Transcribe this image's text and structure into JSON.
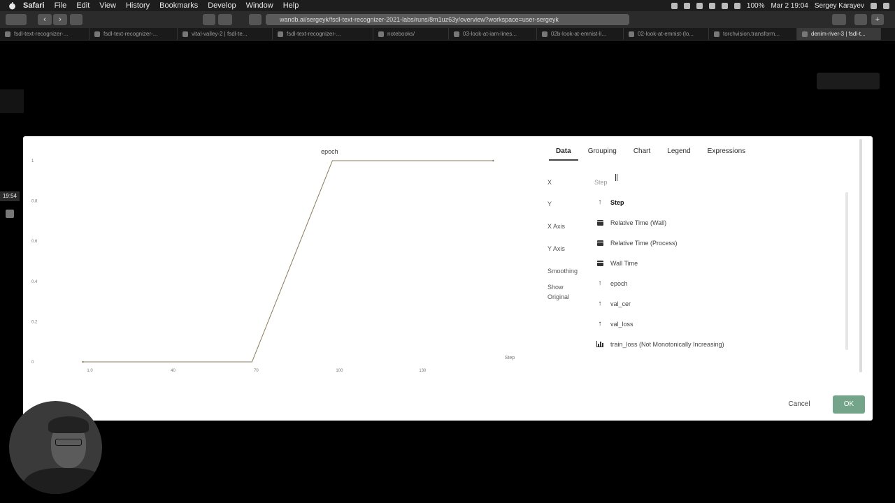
{
  "menubar": {
    "app_name": "Safari",
    "menus": [
      "File",
      "Edit",
      "View",
      "History",
      "Bookmarks",
      "Develop",
      "Window",
      "Help"
    ],
    "battery": "100%",
    "date_time": "Mar 2  19:04",
    "user": "Sergey Karayev"
  },
  "browser": {
    "url": "wandb.ai/sergeyk/fsdl-text-recognizer-2021-labs/runs/8m1uz63y/overview?workspace=user-sergeyk",
    "tabs": [
      {
        "label": "fsdl-text-recognizer-..."
      },
      {
        "label": "fsdl-text-recognizer-..."
      },
      {
        "label": "vital-valley-2 | fsdl-te..."
      },
      {
        "label": "fsdl-text-recognizer-..."
      },
      {
        "label": "notebooks/"
      },
      {
        "label": "03-look-at-iam-lines..."
      },
      {
        "label": "02b-look-at-emnist-li..."
      },
      {
        "label": "02-look-at-emnist-(lo..."
      },
      {
        "label": "torchvision.transform..."
      },
      {
        "label": "denim-river-3 | fsdl-t..."
      }
    ]
  },
  "background": {
    "time_label": "19:54"
  },
  "chart_data": {
    "type": "line",
    "title": "epoch",
    "xlabel": "Step",
    "ylabel": "",
    "x": [
      10,
      71,
      100,
      158
    ],
    "y": [
      0,
      0,
      1,
      1
    ],
    "xlim": [
      -4,
      170
    ],
    "ylim": [
      0,
      1
    ],
    "xticks": [
      10,
      40,
      70,
      100,
      130
    ],
    "xtick_labels": [
      "1.0",
      "40",
      "70",
      "100",
      "130"
    ],
    "yticks": [
      0,
      0.2,
      0.4,
      0.6,
      0.8,
      1
    ],
    "ytick_labels": [
      "0",
      "0.2",
      "0.4",
      "0.6",
      "0.8",
      "1"
    ],
    "line_color": "#8a7a5a",
    "grid": false,
    "legend": "none"
  },
  "config": {
    "tabs": [
      {
        "label": "Data",
        "active": true
      },
      {
        "label": "Grouping"
      },
      {
        "label": "Chart"
      },
      {
        "label": "Legend"
      },
      {
        "label": "Expressions"
      }
    ],
    "fields": {
      "x": "X",
      "y": "Y",
      "x_axis": "X Axis",
      "y_axis": "Y Axis",
      "smoothing": "Smoothing",
      "show_original_1": "Show",
      "show_original_2": "Original"
    },
    "x_select_value": "Step",
    "options": [
      {
        "label": "Step",
        "icon": "arrow-up-icon"
      },
      {
        "label": "Relative Time (Wall)",
        "icon": "calendar-icon"
      },
      {
        "label": "Relative Time (Process)",
        "icon": "calendar-icon"
      },
      {
        "label": "Wall Time",
        "icon": "calendar-icon"
      },
      {
        "label": "epoch",
        "icon": "arrow-up-icon"
      },
      {
        "label": "val_cer",
        "icon": "arrow-up-icon"
      },
      {
        "label": "val_loss",
        "icon": "arrow-up-icon"
      },
      {
        "label": "train_loss (Not Monotonically Increasing)",
        "icon": "bar-chart-icon"
      }
    ]
  },
  "buttons": {
    "cancel": "Cancel",
    "ok": "OK"
  },
  "colors": {
    "ok_button": "#74a58a",
    "modal_bg": "#ffffff",
    "screen_bg": "#000000"
  }
}
